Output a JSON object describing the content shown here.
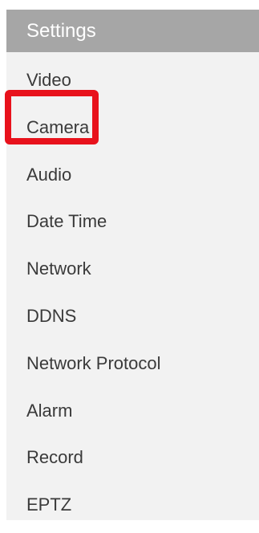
{
  "settings": {
    "title": "Settings",
    "items": [
      {
        "label": "Video"
      },
      {
        "label": "Camera"
      },
      {
        "label": "Audio"
      },
      {
        "label": "Date Time"
      },
      {
        "label": "Network"
      },
      {
        "label": "DDNS"
      },
      {
        "label": "Network Protocol"
      },
      {
        "label": "Alarm"
      },
      {
        "label": "Record"
      },
      {
        "label": "EPTZ"
      }
    ],
    "highlighted_item": "Camera"
  },
  "colors": {
    "header_bg": "#a6a6a6",
    "panel_bg": "#f2f2f2",
    "highlight_border": "#e8121c",
    "text": "#3a3a3a"
  }
}
